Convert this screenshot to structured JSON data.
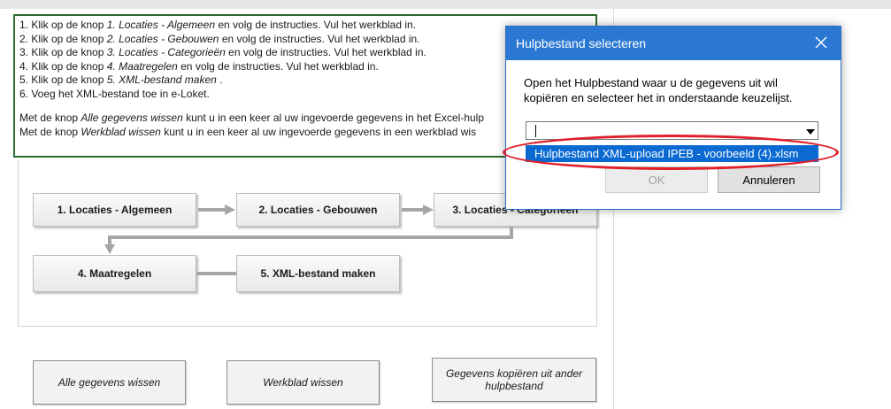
{
  "instructions": {
    "line1_pre": "1. Klik op de knop ",
    "line1_em": "1. Locaties - Algemeen",
    "line1_post": "  en volg de instructies. Vul het werkblad in.",
    "line2_pre": "2. Klik op de knop ",
    "line2_em": "2. Locaties - Gebouwen",
    "line2_post": "  en volg de instructies. Vul het werkblad in.",
    "line3_pre": "3. Klik op de knop ",
    "line3_em": "3. Locaties - Categorieën",
    "line3_post": "  en volg de instructies. Vul het werkblad in.",
    "line4_pre": "4. Klik op de knop ",
    "line4_em": "4. Maatregelen",
    "line4_post": "  en volg de instructies. Vul het werkblad in.",
    "line5_pre": "5. Klik op de knop ",
    "line5_em": "5. XML-bestand  maken",
    "line5_post": " .",
    "line6": "6. Voeg het XML-bestand toe in e-Loket.",
    "note1_pre": "Met de knop ",
    "note1_em": "Alle gegevens wissen",
    "note1_post": "  kunt u in een keer al uw ingevoerde gegevens in het Excel-hulp",
    "note2_pre": "Met de knop ",
    "note2_em": "Werkblad wissen",
    "note2_post": "  kunt u in een keer al uw ingevoerde gegevens in een werkblad wis"
  },
  "flow": {
    "btn1": "1. Locaties - Algemeen",
    "btn2": "2. Locaties - Gebouwen",
    "btn3": "3. Locaties - Categorieën",
    "btn4": "4. Maatregelen",
    "btn5": "5. XML-bestand maken"
  },
  "actions": {
    "clear_all": "Alle gegevens wissen",
    "clear_sheet": "Werkblad wissen",
    "copy_data": "Gegevens kopiëren uit ander hulpbestand"
  },
  "dialog": {
    "title": "Hulpbestand selecteren",
    "message_line1": "Open het Hulpbestand waar u de gegevens uit wil",
    "message_line2": "kopiëren en selecteer het in onderstaande keuzelijst.",
    "combo_value": "",
    "list_item": "Hulpbestand XML-upload IPEB - voorbeeld (4).xlsm",
    "ok": "OK",
    "cancel": "Annuleren"
  },
  "colors": {
    "titlebar": "#2b78d2",
    "selection": "#0a6ad2",
    "highlight_ellipse": "#e0202a",
    "instructions_border": "#2e6b2e"
  },
  "icons": {
    "close": "close-icon",
    "dropdown": "chevron-down-icon"
  }
}
